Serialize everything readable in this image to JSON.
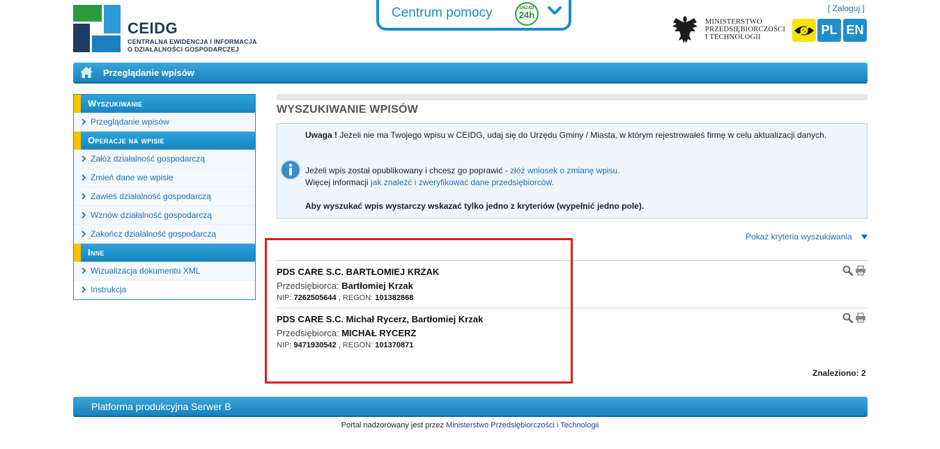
{
  "header": {
    "brand_title": "CEIDG",
    "brand_sub_line1": "CENTRALNA EWIDENCJA I INFORMACJA",
    "brand_sub_line2": "O DZIAŁALNOŚCI GOSPODARCZEJ",
    "help_label": "Centrum pomocy",
    "urzad_badge_top": "URZĄD",
    "urzad_badge_bottom": "24h",
    "login_open": "[ ",
    "login_label": "Zaloguj",
    "login_close": " ]",
    "ministry_line1": "MINISTERSTWO",
    "ministry_line2": "PRZEDSIĘBIORCZOŚCI",
    "ministry_line3": "I TECHNOLOGII",
    "lang_pl": "PL",
    "lang_en": "EN"
  },
  "nav": {
    "title": "Przeglądanie wpisów"
  },
  "sidebar": {
    "sections": [
      {
        "heading": "Wyszukiwanie",
        "items": [
          "Przeglądanie wpisów"
        ]
      },
      {
        "heading": "Operacje na wpisie",
        "items": [
          "Załóż działalność gospodarczą",
          "Zmień dane we wpisie",
          "Zawieś działalność gospodarczą",
          "Wznów działalność gospodarczą",
          "Zakończ działalność gospodarczą"
        ]
      },
      {
        "heading": "Inne",
        "items": [
          "Wizualizacja dokumentu XML",
          "Instrukcja"
        ]
      }
    ]
  },
  "main": {
    "title": "WYSZUKIWANIE WPISÓW",
    "info": {
      "warning_label": "Uwaga !",
      "warning_text": " Jeżeli nie ma Twojego wpisu w CEIDG, udaj się do Urzędu Gminy / Miasta, w którym rejestrowałeś firmę w celu aktualizacji danych.",
      "fix_text": "Jeżeli wpis został opublikowany i chcesz go poprawić - ",
      "fix_link": "złóż wniosek o zmianę wpisu.",
      "more_text": "Więcej informacji ",
      "more_link": "jak znaleźć i zweryfikować dane przedsiębiorców.",
      "criteria_note": "Aby wyszukać wpis wystarczy wskazać tylko jedno z kryteriów (wypełnić jedno pole)."
    },
    "toggle_criteria": "Pokaż kryteria wyszukiwania",
    "owner_label": "Przedsiębiorca: ",
    "nip_label": "NIP: ",
    "regon_label": " , REGON: ",
    "results": [
      {
        "name": "PDS CARE S.C. BARTŁOMIEJ KRZAK",
        "owner": "Bartłomiej Krzak",
        "nip": "7262505644",
        "regon": "101382868"
      },
      {
        "name": "PDS CARE S.C. Michał Rycerz, Bartłomiej Krzak",
        "owner": "MICHAŁ RYCERZ",
        "nip": "9471930542",
        "regon": "101370871"
      }
    ],
    "found": "Znaleziono: 2"
  },
  "footer": {
    "platform": "Platforma produkcyjna Serwer B",
    "portal_text": "Portal nadzorowany jest przez ",
    "portal_link": "Ministerstwo Przedsiębiorczości i Technologii"
  },
  "colors": {
    "accent_blue": "#1a8fc7",
    "sidebar_marker": "#f2c400",
    "highlight_red": "#e21b1b"
  }
}
